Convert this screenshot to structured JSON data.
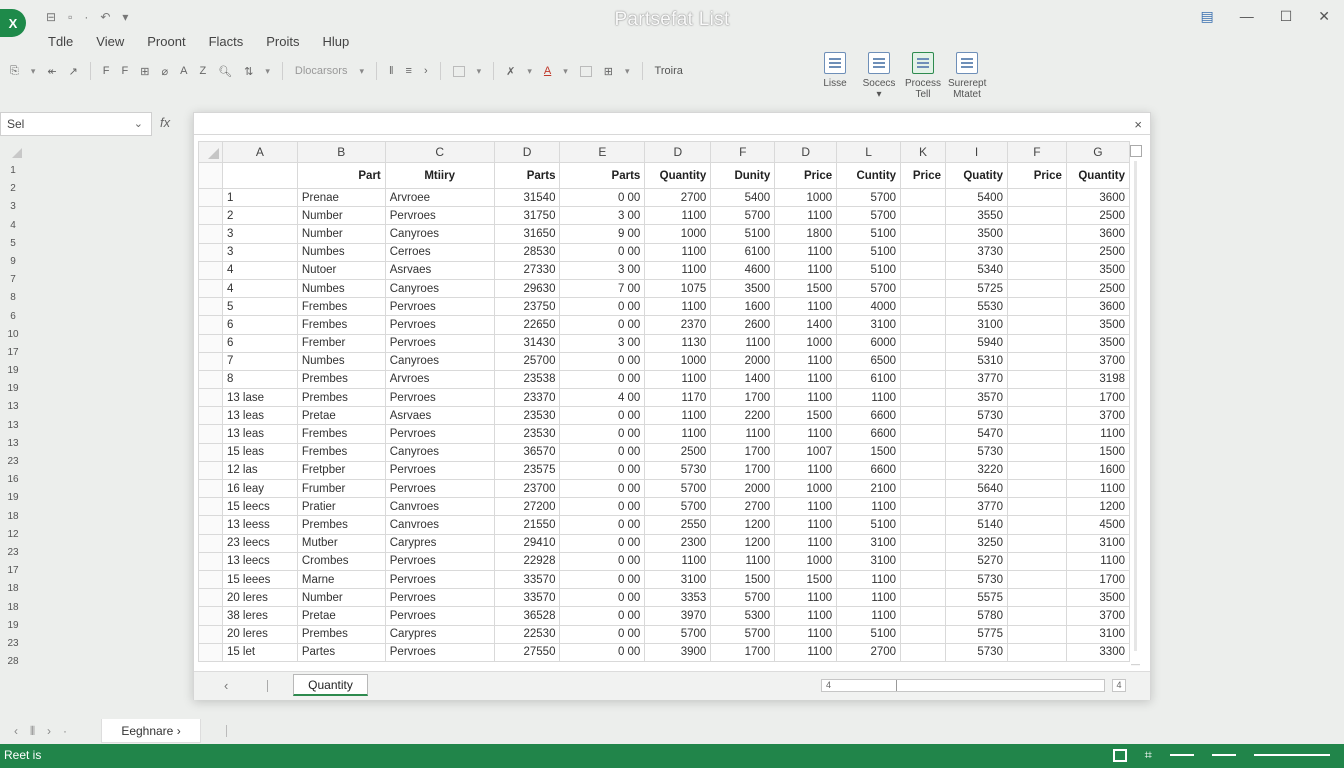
{
  "window": {
    "logo": "X",
    "title": "Partsefat List",
    "qat": [
      "⊟",
      "▫",
      "·",
      "↶",
      "▾"
    ]
  },
  "menu": [
    "Tdle",
    "View",
    "Proont",
    "Flacts",
    "Proits",
    "Hlup"
  ],
  "ribbon": {
    "font_name": "Dlocarsors",
    "style_label": "Troira",
    "tools": [
      {
        "label1": "Lisse",
        "label2": ""
      },
      {
        "label1": "Socecs",
        "label2": "▾"
      },
      {
        "label1": "Process",
        "label2": "Tell"
      },
      {
        "label1": "Surerept",
        "label2": "Mtatet"
      }
    ]
  },
  "formula_bar": {
    "name_box": "Sel",
    "fx_label": "fx"
  },
  "outer_row_numbers": [
    "1",
    "2",
    "3",
    "4",
    "5",
    "9",
    "7",
    "8",
    "6",
    "10",
    "17",
    "19",
    "19",
    "13",
    "13",
    "13",
    "23",
    "16",
    "19",
    "18",
    "12",
    "23",
    "17",
    "18",
    "18",
    "19",
    "23",
    "28"
  ],
  "sheet": {
    "columns": [
      "A",
      "B",
      "C",
      "D",
      "E",
      "D",
      "F",
      "D",
      "L",
      "K",
      "I",
      "F",
      "G"
    ],
    "header_row": [
      "",
      "Part",
      "Mtiiry",
      "Parts",
      "Parts",
      "Quantity",
      "Dunity",
      "Price",
      "Cuntity",
      "Price",
      "Quatity",
      "Price",
      "Quantity"
    ],
    "rows": [
      {
        "n": "1",
        "a": "1",
        "b": "Prenae",
        "c": "Arvroee",
        "d": "31540",
        "e": "0 00",
        "f": "2700",
        "g": "5400",
        "h": "1000",
        "i": "5700",
        "j": "",
        "k": "5400",
        "l": "",
        "m": "3600"
      },
      {
        "n": "2",
        "a": "2",
        "b": "Number",
        "c": "Pervroes",
        "d": "31750",
        "e": "3 00",
        "f": "1100",
        "g": "5700",
        "h": "1100",
        "i": "5700",
        "j": "",
        "k": "3550",
        "l": "",
        "m": "2500"
      },
      {
        "n": "3",
        "a": "3",
        "b": "Number",
        "c": "Canyroes",
        "d": "31650",
        "e": "9 00",
        "f": "1000",
        "g": "5100",
        "h": "1800",
        "i": "5100",
        "j": "",
        "k": "3500",
        "l": "",
        "m": "3600"
      },
      {
        "n": "4",
        "a": "3",
        "b": "Numbes",
        "c": "Cerroes",
        "d": "28530",
        "e": "0 00",
        "f": "1100",
        "g": "6100",
        "h": "1100",
        "i": "5100",
        "j": "",
        "k": "3730",
        "l": "",
        "m": "2500"
      },
      {
        "n": "5",
        "a": "4",
        "b": "Nutoer",
        "c": "Asrvaes",
        "d": "27330",
        "e": "3 00",
        "f": "1100",
        "g": "4600",
        "h": "1100",
        "i": "5100",
        "j": "",
        "k": "5340",
        "l": "",
        "m": "3500"
      },
      {
        "n": "9",
        "a": "4",
        "b": "Numbes",
        "c": "Canyroes",
        "d": "29630",
        "e": "7 00",
        "f": "1075",
        "g": "3500",
        "h": "1500",
        "i": "5700",
        "j": "",
        "k": "5725",
        "l": "",
        "m": "2500"
      },
      {
        "n": "7",
        "a": "5",
        "b": "Frembes",
        "c": "Pervroes",
        "d": "23750",
        "e": "0 00",
        "f": "1100",
        "g": "1600",
        "h": "1100",
        "i": "4000",
        "j": "",
        "k": "5530",
        "l": "",
        "m": "3600"
      },
      {
        "n": "8",
        "a": "6",
        "b": "Frembes",
        "c": "Pervroes",
        "d": "22650",
        "e": "0 00",
        "f": "2370",
        "g": "2600",
        "h": "1400",
        "i": "3100",
        "j": "",
        "k": "3100",
        "l": "",
        "m": "3500"
      },
      {
        "n": "6",
        "a": "6",
        "b": "Frember",
        "c": "Pervroes",
        "d": "31430",
        "e": "3 00",
        "f": "1130",
        "g": "1100",
        "h": "1000",
        "i": "6000",
        "j": "",
        "k": "5940",
        "l": "",
        "m": "3500"
      },
      {
        "n": "10",
        "a": "7",
        "b": "Numbes",
        "c": "Canyroes",
        "d": "25700",
        "e": "0 00",
        "f": "1000",
        "g": "2000",
        "h": "1100",
        "i": "6500",
        "j": "",
        "k": "5310",
        "l": "",
        "m": "3700"
      },
      {
        "n": "17",
        "a": "8",
        "b": "Prembes",
        "c": "Arvroes",
        "d": "23538",
        "e": "0 00",
        "f": "1100",
        "g": "1400",
        "h": "1100",
        "i": "6100",
        "j": "",
        "k": "3770",
        "l": "",
        "m": "3198"
      },
      {
        "n": "19",
        "a": "13 lase",
        "b": "Prembes",
        "c": "Pervroes",
        "d": "23370",
        "e": "4 00",
        "f": "1170",
        "g": "1700",
        "h": "1100",
        "i": "1100",
        "j": "",
        "k": "3570",
        "l": "",
        "m": "1700"
      },
      {
        "n": "19",
        "a": "13 leas",
        "b": "Pretae",
        "c": "Asrvaes",
        "d": "23530",
        "e": "0 00",
        "f": "1100",
        "g": "2200",
        "h": "1500",
        "i": "6600",
        "j": "",
        "k": "5730",
        "l": "",
        "m": "3700"
      },
      {
        "n": "13",
        "a": "13 leas",
        "b": "Frembes",
        "c": "Pervroes",
        "d": "23530",
        "e": "0 00",
        "f": "1100",
        "g": "1100",
        "h": "1100",
        "i": "6600",
        "j": "",
        "k": "5470",
        "l": "",
        "m": "1100"
      },
      {
        "n": "13",
        "a": "15 leas",
        "b": "Frembes",
        "c": "Canyroes",
        "d": "36570",
        "e": "0 00",
        "f": "2500",
        "g": "1700",
        "h": "1007",
        "i": "1500",
        "j": "",
        "k": "5730",
        "l": "",
        "m": "1500"
      },
      {
        "n": "13",
        "a": "12 las",
        "b": "Fretpber",
        "c": "Pervroes",
        "d": "23575",
        "e": "0 00",
        "f": "5730",
        "g": "1700",
        "h": "1100",
        "i": "6600",
        "j": "",
        "k": "3220",
        "l": "",
        "m": "1600"
      },
      {
        "n": "23",
        "a": "16 leay",
        "b": "Frumber",
        "c": "Pervroes",
        "d": "23700",
        "e": "0 00",
        "f": "5700",
        "g": "2000",
        "h": "1000",
        "i": "2100",
        "j": "",
        "k": "5640",
        "l": "",
        "m": "1100"
      },
      {
        "n": "16",
        "a": "15 leecs",
        "b": "Pratier",
        "c": "Canvroes",
        "d": "27200",
        "e": "0 00",
        "f": "5700",
        "g": "2700",
        "h": "1100",
        "i": "1100",
        "j": "",
        "k": "3770",
        "l": "",
        "m": "1200"
      },
      {
        "n": "19",
        "a": "13 leess",
        "b": "Prembes",
        "c": "Canvroes",
        "d": "21550",
        "e": "0 00",
        "f": "2550",
        "g": "1200",
        "h": "1100",
        "i": "5100",
        "j": "",
        "k": "5140",
        "l": "",
        "m": "4500"
      },
      {
        "n": "18",
        "a": "23 leecs",
        "b": "Mutber",
        "c": "Carypres",
        "d": "29410",
        "e": "0 00",
        "f": "2300",
        "g": "1200",
        "h": "1100",
        "i": "3100",
        "j": "",
        "k": "3250",
        "l": "",
        "m": "3100"
      },
      {
        "n": "12",
        "a": "13 leecs",
        "b": "Crombes",
        "c": "Pervroes",
        "d": "22928",
        "e": "0 00",
        "f": "1100",
        "g": "1100",
        "h": "1000",
        "i": "3100",
        "j": "",
        "k": "5270",
        "l": "",
        "m": "1100"
      },
      {
        "n": "23",
        "a": "15 leees",
        "b": "Marne",
        "c": "Pervroes",
        "d": "33570",
        "e": "0 00",
        "f": "3100",
        "g": "1500",
        "h": "1500",
        "i": "1100",
        "j": "",
        "k": "5730",
        "l": "",
        "m": "1700"
      },
      {
        "n": "17",
        "a": "20 leres",
        "b": "Number",
        "c": "Pervroes",
        "d": "33570",
        "e": "0 00",
        "f": "3353",
        "g": "5700",
        "h": "1100",
        "i": "1100",
        "j": "",
        "k": "5575",
        "l": "",
        "m": "3500"
      },
      {
        "n": "18",
        "a": "38 leres",
        "b": "Pretae",
        "c": "Pervroes",
        "d": "36528",
        "e": "0 00",
        "f": "3970",
        "g": "5300",
        "h": "1100",
        "i": "1100",
        "j": "",
        "k": "5780",
        "l": "",
        "m": "3700"
      },
      {
        "n": "18",
        "a": "20 leres",
        "b": "Prembes",
        "c": "Carypres",
        "d": "22530",
        "e": "0 00",
        "f": "5700",
        "g": "5700",
        "h": "1100",
        "i": "5100",
        "j": "",
        "k": "5775",
        "l": "",
        "m": "3100"
      },
      {
        "n": "19",
        "a": "15 let",
        "b": "Partes",
        "c": "Pervroes",
        "d": "27550",
        "e": "0 00",
        "f": "3900",
        "g": "1700",
        "h": "1100",
        "i": "2700",
        "j": "",
        "k": "5730",
        "l": "",
        "m": "3300"
      }
    ]
  },
  "dialog": {
    "close": "×",
    "footer_prev": "‹",
    "footer_tab": "Quantity",
    "hscroll_label": "4",
    "hscroll2_label": "4"
  },
  "sheet_tabs": {
    "nav": [
      "‹",
      "⫴",
      "›",
      "·"
    ],
    "active": "Eeghnare ›"
  },
  "status": {
    "text": "Reet is"
  }
}
